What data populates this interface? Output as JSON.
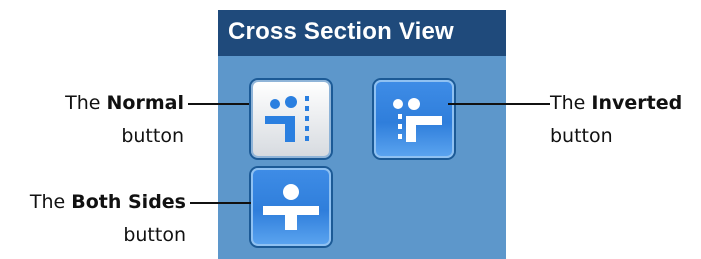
{
  "panel": {
    "title": "Cross Section View"
  },
  "buttons": {
    "normal": {
      "icon": "cross-section-normal-icon"
    },
    "inverted": {
      "icon": "cross-section-inverted-icon"
    },
    "both_sides": {
      "icon": "cross-section-both-sides-icon"
    }
  },
  "callouts": {
    "normal": {
      "prefix": "The",
      "name": "Normal",
      "suffix": "button"
    },
    "inverted": {
      "prefix": "The",
      "name": "Inverted",
      "suffix": "button"
    },
    "both_sides": {
      "prefix": "The",
      "name": "Both Sides",
      "suffix": "button"
    }
  },
  "colors": {
    "header": "#1f4a7b",
    "panel": "#5d97cb",
    "icon_blue": "#2a7fe0",
    "icon_white": "#ffffff"
  }
}
